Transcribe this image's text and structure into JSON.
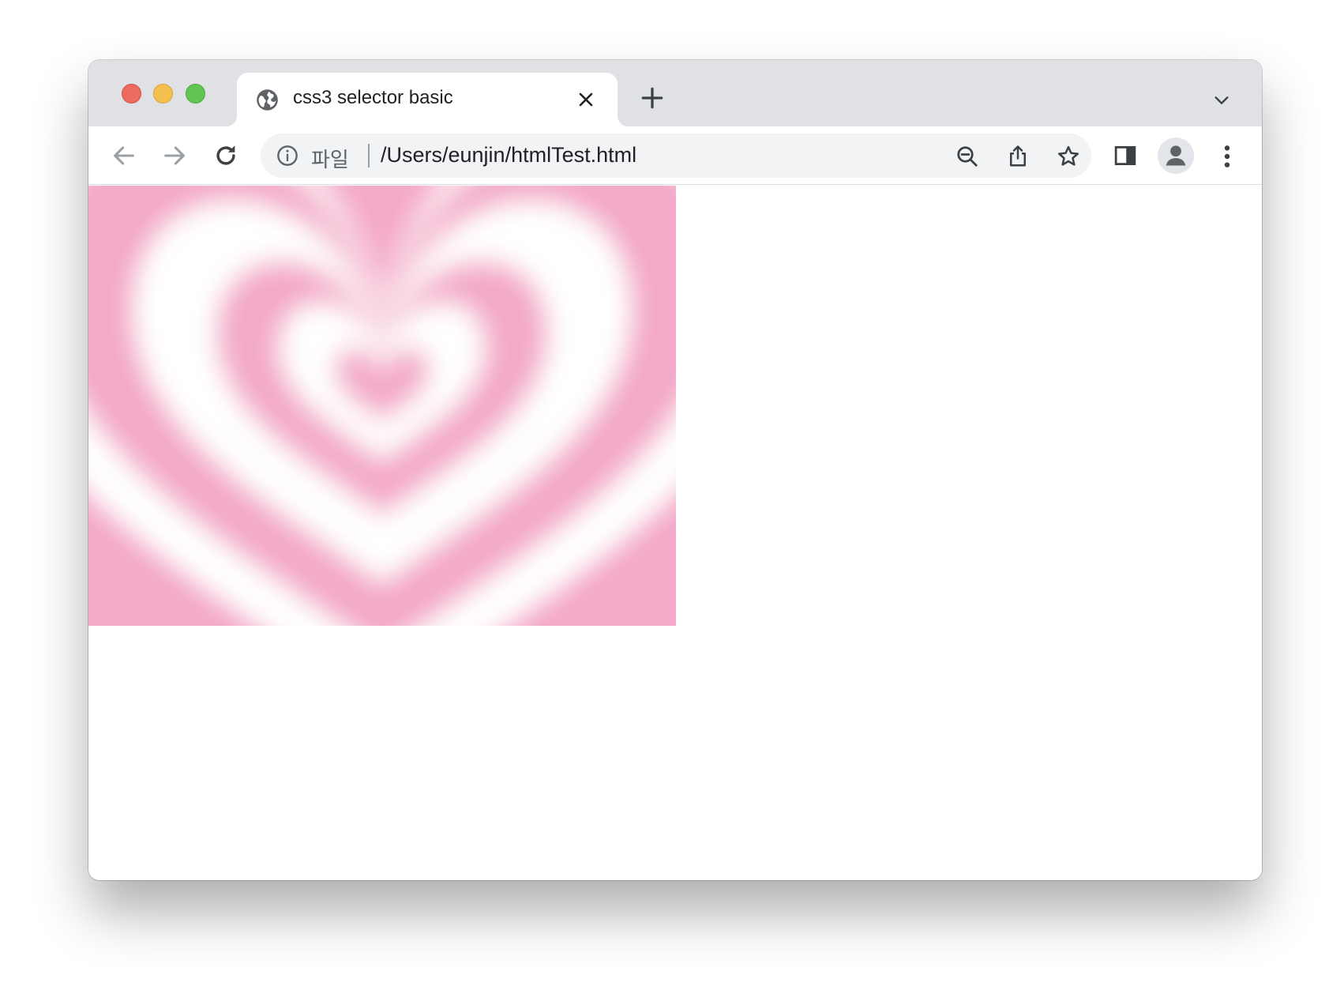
{
  "window": {
    "controls": [
      "close",
      "minimize",
      "maximize"
    ]
  },
  "tab": {
    "title": "css3 selector basic",
    "favicon": "globe-icon",
    "close_icon": "close-icon"
  },
  "tabstrip": {
    "new_tab_icon": "plus-icon",
    "dropdown_icon": "chevron-down-icon"
  },
  "toolbar": {
    "back_icon": "arrow-left-icon",
    "forward_icon": "arrow-right-icon",
    "reload_icon": "reload-icon",
    "side_panel_icon": "side-panel-icon",
    "profile_icon": "person-icon",
    "menu_icon": "more-vert-icon"
  },
  "omnibox": {
    "info_icon": "info-icon",
    "scheme_label": "파일",
    "url": "/Users/eunjin/htmlTest.html",
    "actions": [
      "zoom-out-icon",
      "share-icon",
      "star-icon"
    ]
  },
  "content": {
    "image": {
      "subject": "pink concentric hearts",
      "colors": {
        "pink": "#f3a9c8",
        "white": "#ffffff"
      }
    }
  }
}
